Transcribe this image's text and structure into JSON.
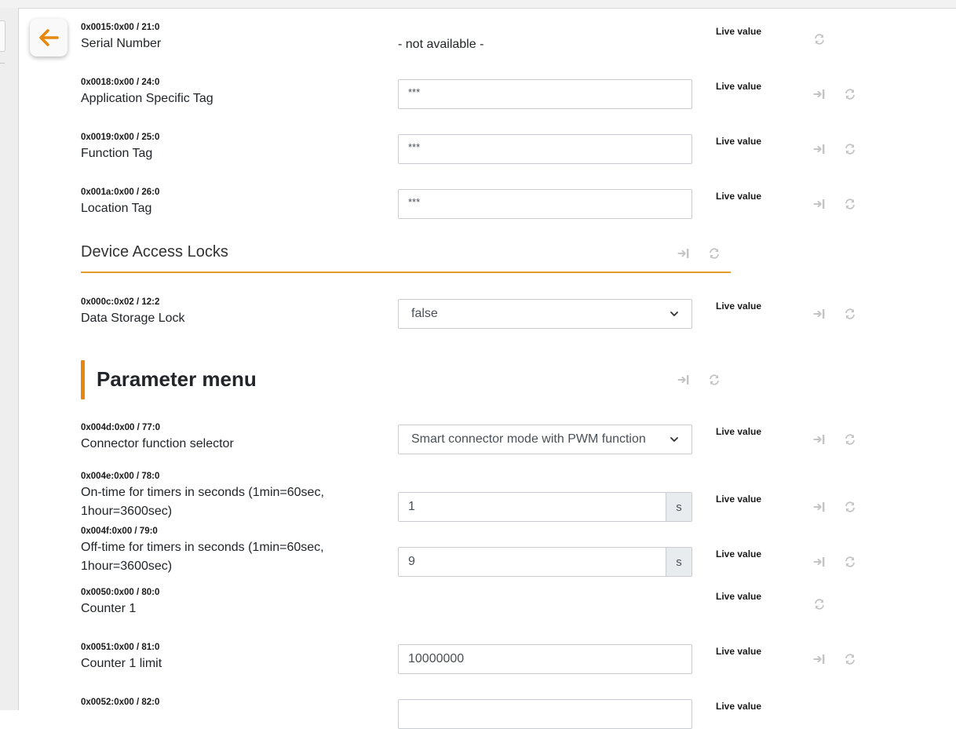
{
  "ui": {
    "live_label": "Live value",
    "colors": {
      "accent": "#e8870e",
      "icon_gray": "#c4c4c4"
    },
    "icons": [
      "arrow-left-icon",
      "write-icon",
      "refresh-icon",
      "chevron-down-icon"
    ]
  },
  "rows": {
    "serial": {
      "addr": "0x0015:0x00 / 21:0",
      "name": "Serial Number",
      "value": "- not available -"
    },
    "app_tag": {
      "addr": "0x0018:0x00 / 24:0",
      "name": "Application Specific Tag",
      "value": "***"
    },
    "func_tag": {
      "addr": "0x0019:0x00 / 25:0",
      "name": "Function Tag",
      "value": "***"
    },
    "loc_tag": {
      "addr": "0x001a:0x00 / 26:0",
      "name": "Location Tag",
      "value": "***"
    },
    "storage_lock": {
      "addr": "0x000c:0x02 / 12:2",
      "name": "Data Storage Lock",
      "value": "false"
    },
    "connector": {
      "addr": "0x004d:0x00 / 77:0",
      "name": "Connector function selector",
      "value": "Smart connector mode with PWM function"
    },
    "on_time": {
      "addr": "0x004e:0x00 / 78:0",
      "name_l1": "On-time for timers in seconds (1min=60sec,",
      "name_l2": "1hour=3600sec)",
      "value": "1",
      "unit": "s"
    },
    "off_time": {
      "addr": "0x004f:0x00 / 79:0",
      "name_l1": "Off-time for timers in seconds (1min=60sec,",
      "name_l2": "1hour=3600sec)",
      "value": "9",
      "unit": "s"
    },
    "counter1": {
      "addr": "0x0050:0x00 / 80:0",
      "name": "Counter 1"
    },
    "counter1_limit": {
      "addr": "0x0051:0x00 / 81:0",
      "name": "Counter 1 limit",
      "value": "10000000"
    },
    "row82": {
      "addr": "0x0052:0x00 / 82:0"
    }
  },
  "sections": {
    "access_locks": "Device Access Locks",
    "parameter_menu": "Parameter menu"
  }
}
